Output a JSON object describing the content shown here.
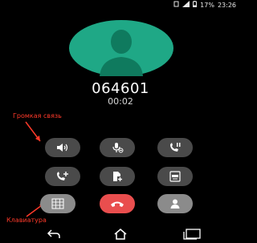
{
  "status_bar": {
    "battery_percent": "17%",
    "time": "23:26",
    "icons": [
      "signal-icon",
      "notification-icon",
      "battery-icon"
    ]
  },
  "call": {
    "number": "064601",
    "duration": "00:02"
  },
  "controls": [
    {
      "name": "speaker-button",
      "icon": "speaker-icon"
    },
    {
      "name": "mute-button",
      "icon": "microphone-muted-icon"
    },
    {
      "name": "hold-button",
      "icon": "phone-pause-icon"
    },
    {
      "name": "add-call-button",
      "icon": "add-call-icon"
    },
    {
      "name": "add-file-button",
      "icon": "document-add-icon"
    },
    {
      "name": "record-button",
      "icon": "record-icon"
    },
    {
      "name": "keypad-button",
      "icon": "keypad-icon"
    },
    {
      "name": "end-call-button",
      "icon": "end-call-icon"
    },
    {
      "name": "contacts-button",
      "icon": "contact-icon"
    }
  ],
  "annotations": {
    "speaker_label": "Громкая связь",
    "keypad_label": "Клавиатура",
    "color": "#ff3a2a"
  },
  "navigation": {
    "icons": [
      "back-icon",
      "home-icon",
      "recent-apps-icon"
    ]
  },
  "colors": {
    "background": "#000000",
    "avatar": "#1fa886",
    "button": "#4a4a4a",
    "button_active": "#8b8b8b",
    "end_call": "#e94e4e"
  }
}
